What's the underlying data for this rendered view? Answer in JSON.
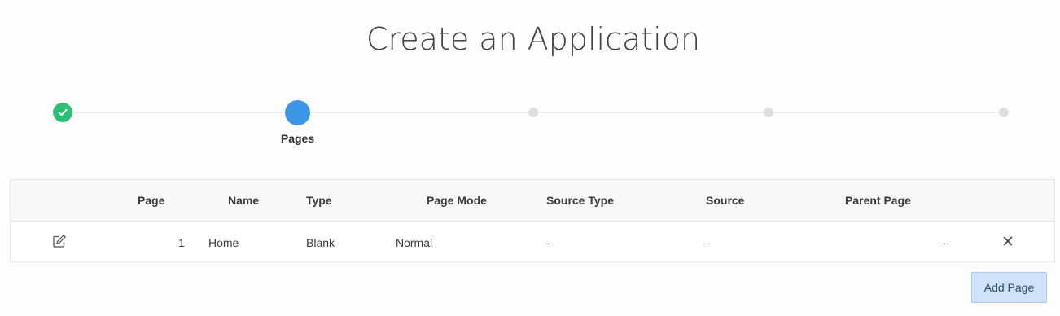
{
  "page": {
    "title": "Create an Application"
  },
  "wizard": {
    "steps": [
      {
        "state": "done",
        "label": ""
      },
      {
        "state": "current",
        "label": "Pages"
      },
      {
        "state": "future",
        "label": ""
      },
      {
        "state": "future",
        "label": ""
      },
      {
        "state": "future",
        "label": ""
      }
    ],
    "colors": {
      "done": "#2ebf76",
      "current": "#3d95e6",
      "future": "#dedede"
    }
  },
  "grid": {
    "columns": {
      "page": "Page",
      "name": "Name",
      "type": "Type",
      "page_mode": "Page Mode",
      "source_type": "Source Type",
      "source": "Source",
      "parent_page": "Parent Page"
    },
    "rows": [
      {
        "page": "1",
        "name": "Home",
        "type": "Blank",
        "page_mode": "Normal",
        "source_type": "-",
        "source": "-",
        "parent_page": "-",
        "edit_icon": "edit-pencil-icon",
        "delete_icon": "close-x-icon"
      }
    ]
  },
  "actions": {
    "add_page_label": "Add Page"
  }
}
